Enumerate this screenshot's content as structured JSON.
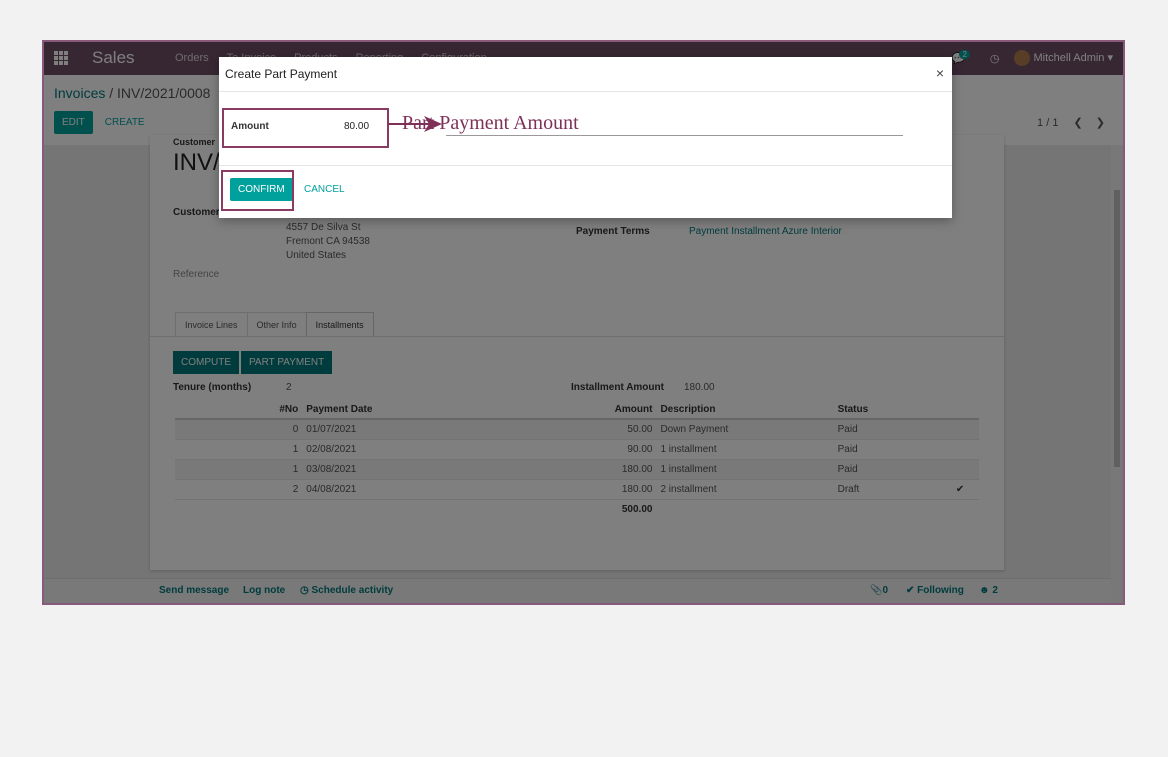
{
  "topbar": {
    "app_name": "Sales",
    "menu": [
      "Orders",
      "To Invoice",
      "Products",
      "Reporting",
      "Configuration"
    ],
    "messages_badge": "2",
    "user": "Mitchell Admin"
  },
  "control": {
    "breadcrumb_parent": "Invoices",
    "breadcrumb_current": "INV/2021/0008",
    "edit_label": "EDIT",
    "create_label": "CREATE",
    "pager": "1 / 1"
  },
  "sheet": {
    "customer_label": "Customer",
    "invoice_title": "INV/",
    "address": [
      "4557 De Silva St",
      "Fremont CA 94538",
      "United States"
    ],
    "reference_label": "Reference",
    "payment_terms_label": "Payment Terms",
    "payment_terms_value": "Payment Installment Azure Interior",
    "tabs": [
      "Invoice Lines",
      "Other Info",
      "Installments"
    ],
    "compute_label": "COMPUTE",
    "part_payment_label": "PART PAYMENT",
    "tenure_label": "Tenure (months)",
    "tenure_value": "2",
    "installment_amount_label": "Installment Amount",
    "installment_amount_value": "180.00",
    "columns": [
      "#No",
      "Payment Date",
      "Amount",
      "Description",
      "Status"
    ],
    "rows": [
      {
        "no": "0",
        "date": "01/07/2021",
        "amount": "50.00",
        "desc": "Down Payment",
        "status": "Paid"
      },
      {
        "no": "1",
        "date": "02/08/2021",
        "amount": "90.00",
        "desc": "1 installment",
        "status": "Paid"
      },
      {
        "no": "1",
        "date": "03/08/2021",
        "amount": "180.00",
        "desc": "1 installment",
        "status": "Paid"
      },
      {
        "no": "2",
        "date": "04/08/2021",
        "amount": "180.00",
        "desc": "2 installment",
        "status": "Draft"
      }
    ],
    "total": "500.00"
  },
  "chatter": {
    "send_message": "Send message",
    "log_note": "Log note",
    "schedule_activity": "Schedule activity",
    "attachments": "0",
    "following": "Following",
    "followers": "2"
  },
  "modal": {
    "title": "Create Part Payment",
    "close": "×",
    "amount_label": "Amount",
    "amount_value": "80.00",
    "confirm_label": "CONFIRM",
    "cancel_label": "CANCEL"
  },
  "annotation": {
    "text": "Part Payment Amount",
    "color": "#7e3058"
  }
}
